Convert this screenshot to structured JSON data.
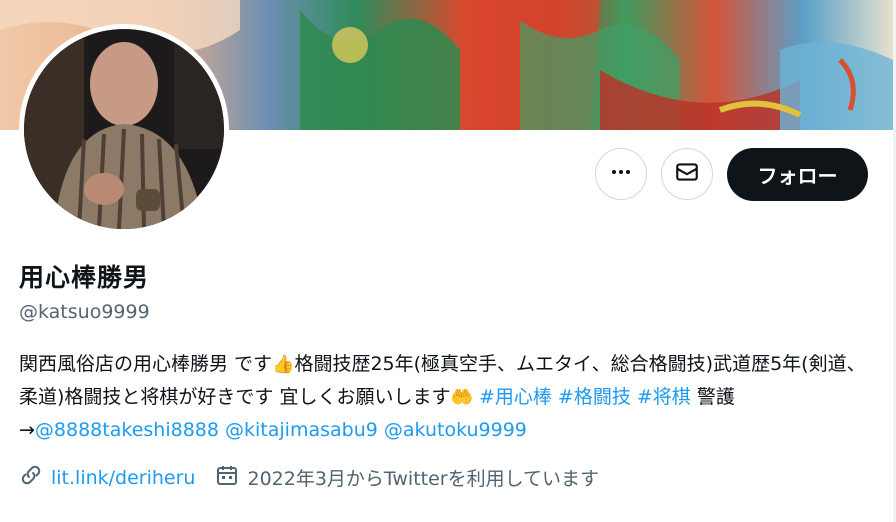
{
  "profile": {
    "name": "用心棒勝男",
    "handle": "@katsuo9999",
    "bio": {
      "text1": "関西風俗店の用心棒勝男 です",
      "emoji1": "👍",
      "text2": "格闘技歴25年(極真空手、ムエタイ、総合格闘技)武道歴5年(剣道、柔道)格闘技と将棋が好きです 宜しくお願いします",
      "emoji2": "🤲",
      "hashtag1": "#用心棒",
      "hashtag2": "#格闘技",
      "hashtag3": "#将棋",
      "text3": "警護→",
      "mention1": "@8888takeshi8888",
      "mention2": "@kitajimasabu9",
      "mention3": "@akutoku9999"
    },
    "website": "lit.link/deriheru",
    "joined": "2022年3月からTwitterを利用しています"
  },
  "actions": {
    "more_icon": "more-horizontal-icon",
    "message_icon": "envelope-icon",
    "follow_label": "フォロー"
  },
  "colors": {
    "link": "#1d9bf0",
    "follow_bg": "#0f1419",
    "secondary_text": "#536471"
  }
}
